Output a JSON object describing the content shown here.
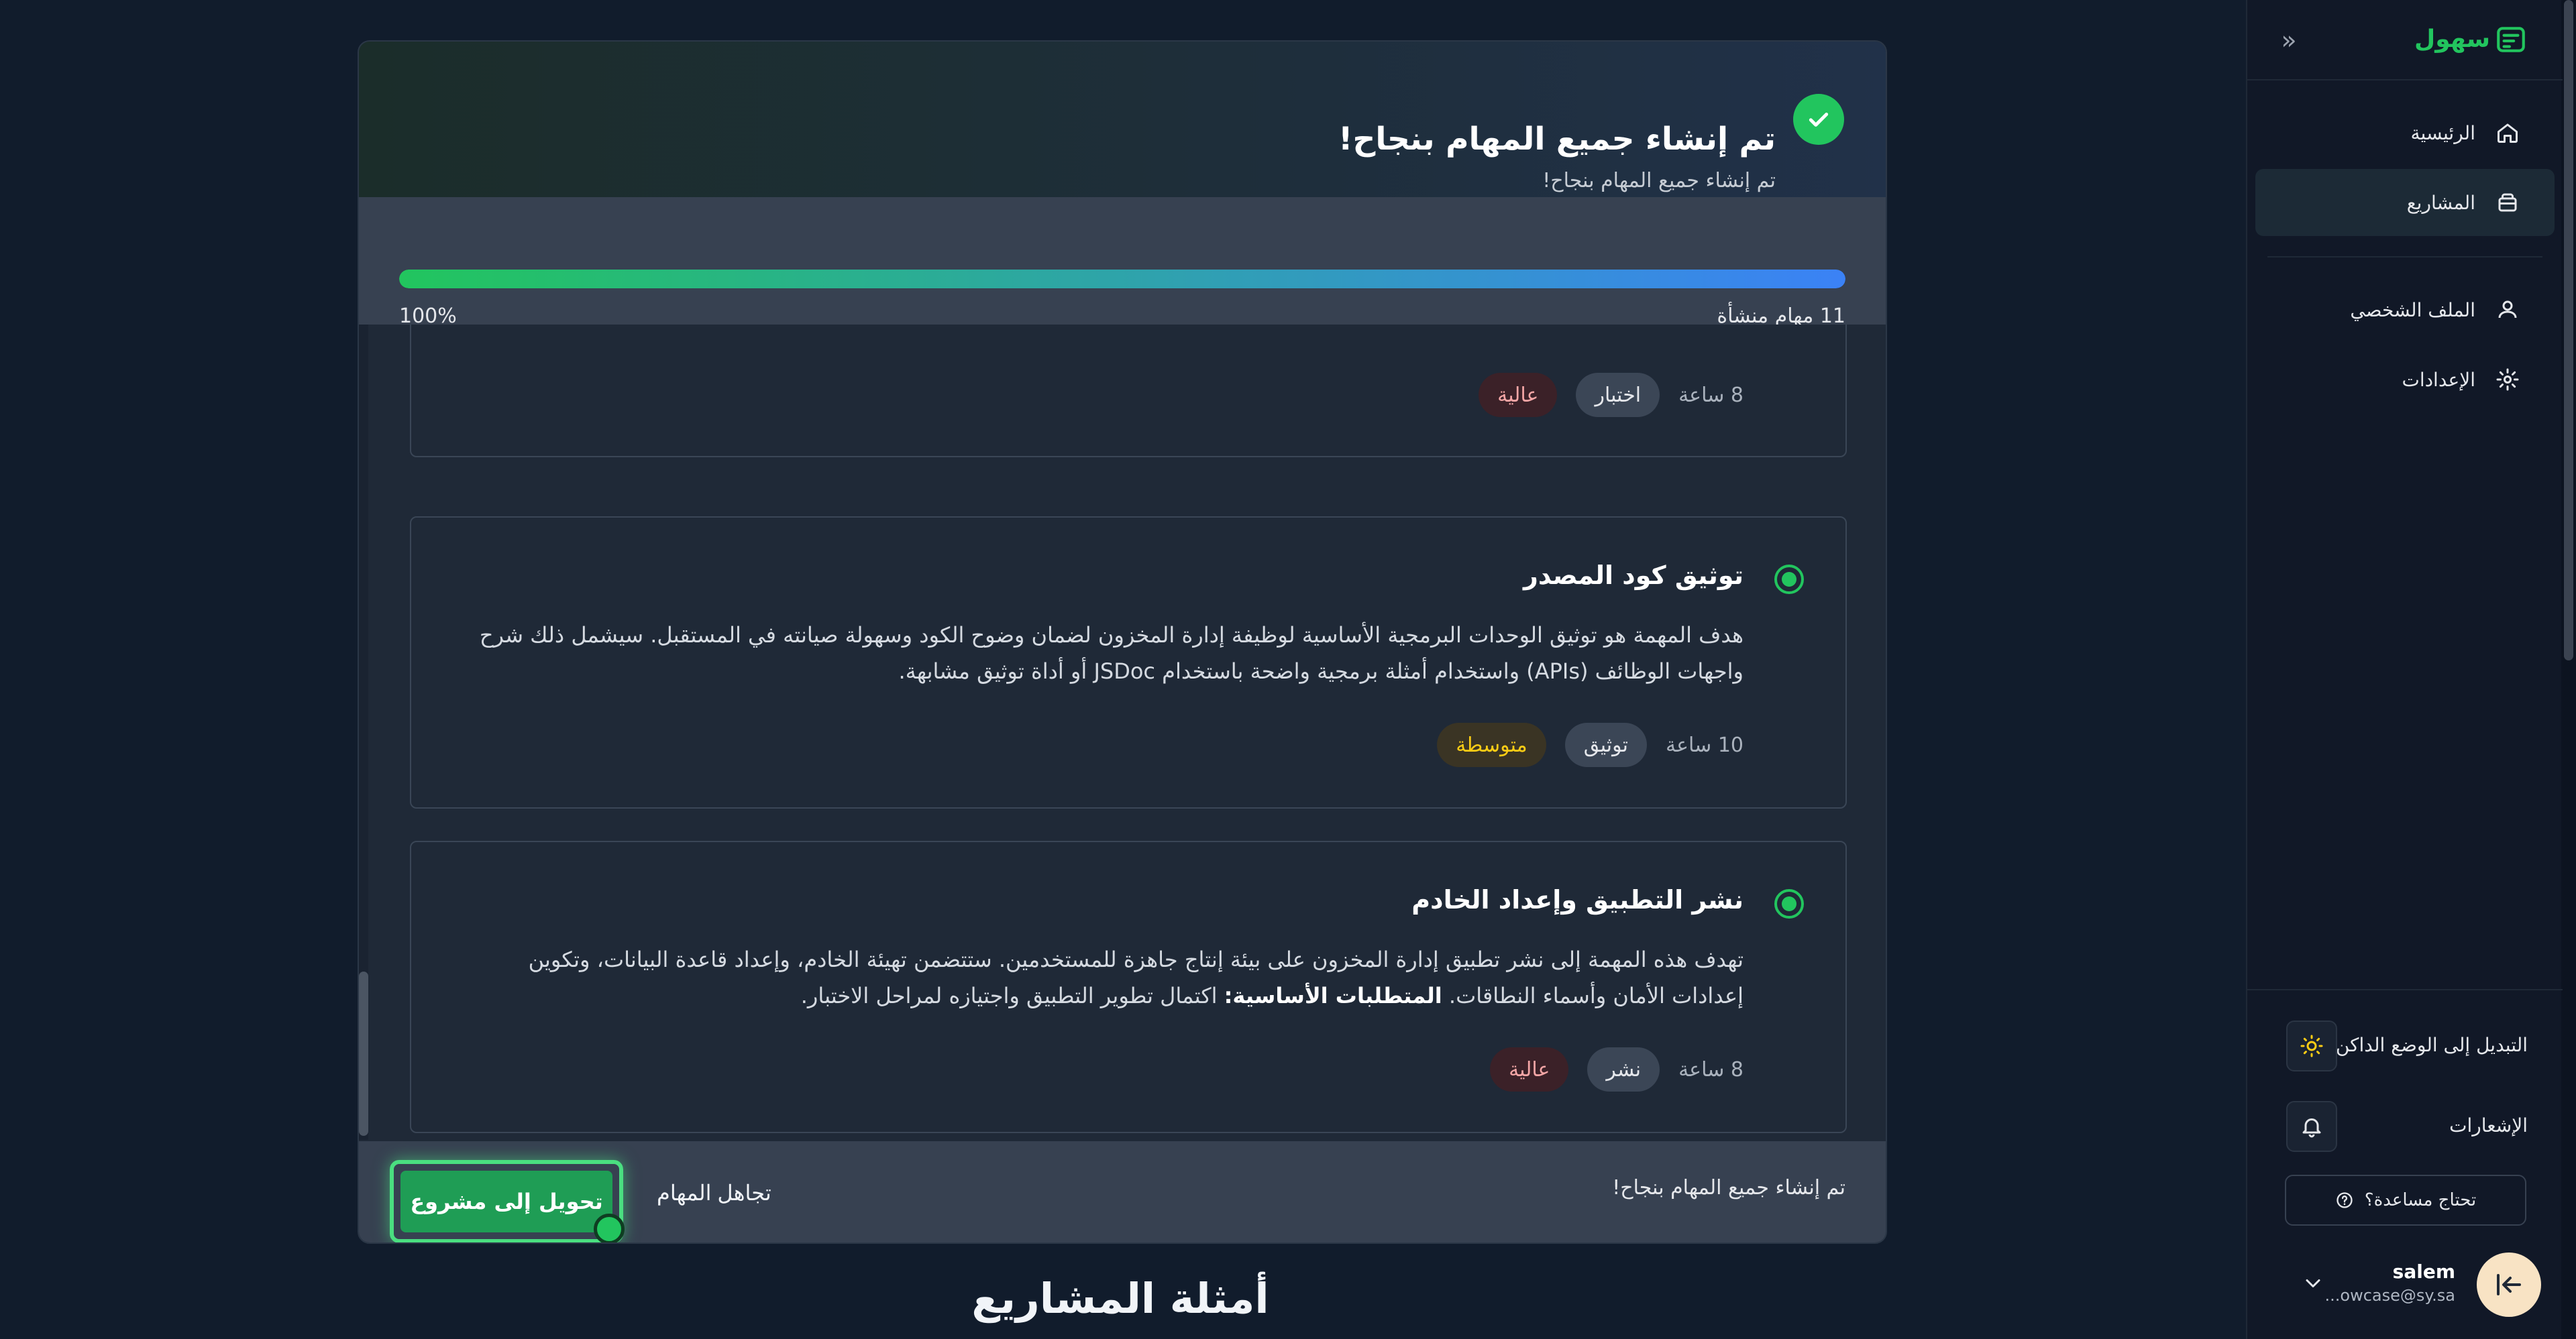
{
  "modal": {
    "title": "تم إنشاء جميع المهام بنجاح!",
    "subtitle": "تم إنشاء جميع المهام بنجاح!",
    "progress": {
      "count_label": "11 مهام منشأة",
      "percent_label": "100%",
      "fraction": 1.0
    },
    "tasks": [
      {
        "title": "",
        "description": "",
        "priority": "عالية",
        "priority_level": "high",
        "type": "اختبار",
        "hours": "8 ساعة"
      },
      {
        "title": "توثيق كود المصدر",
        "description": "هدف المهمة هو توثيق الوحدات البرمجية الأساسية لوظيفة إدارة المخزون لضمان وضوح الكود وسهولة صيانته في المستقبل. سيشمل ذلك شرح واجهات الوظائف (APIs) واستخدام أمثلة برمجية واضحة باستخدام JSDoc أو أداة توثيق مشابهة.",
        "priority": "متوسطة",
        "priority_level": "medium",
        "type": "توثيق",
        "hours": "10 ساعة"
      },
      {
        "title": "نشر التطبيق وإعداد الخادم",
        "description_main": "تهدف هذه المهمة إلى نشر تطبيق إدارة المخزون على بيئة إنتاج جاهزة للمستخدمين. ستتضمن تهيئة الخادم، وإعداد قاعدة البيانات، وتكوين إعدادات الأمان وأسماء النطاقات.",
        "description_req_label": "المتطلبات الأساسية:",
        "description_req": "اكتمال تطوير التطبيق واجتيازه لمراحل الاختبار.",
        "priority": "عالية",
        "priority_level": "high",
        "type": "نشر",
        "hours": "8 ساعة"
      }
    ],
    "footer": {
      "status": "تم إنشاء جميع المهام بنجاح!",
      "ignore_label": "تجاهل المهام",
      "convert_label": "تحويل إلى مشروع"
    }
  },
  "page": {
    "section_title": "أمثلة المشاريع"
  },
  "sidebar": {
    "logo_text": "سهول",
    "nav_items": [
      {
        "label": "الرئيسية",
        "icon": "home-icon",
        "active": false
      },
      {
        "label": "المشاريع",
        "icon": "folder-icon",
        "active": true
      },
      {
        "label": "الملف الشخصي",
        "icon": "user-icon",
        "active": false
      },
      {
        "label": "الإعدادات",
        "icon": "gear-icon",
        "active": false
      }
    ],
    "dark_mode_label": "التبديل إلى الوضع الداكن",
    "notifications_label": "الإشعارات",
    "help_label": "تحتاج مساعدة؟",
    "user": {
      "name": "salem",
      "email": "...owcase@sy.sa"
    }
  },
  "colors": {
    "accent": "#22c55e",
    "progress_end": "#3b82f6",
    "priority_high": "#f4a6a6",
    "priority_medium": "#facc15"
  }
}
